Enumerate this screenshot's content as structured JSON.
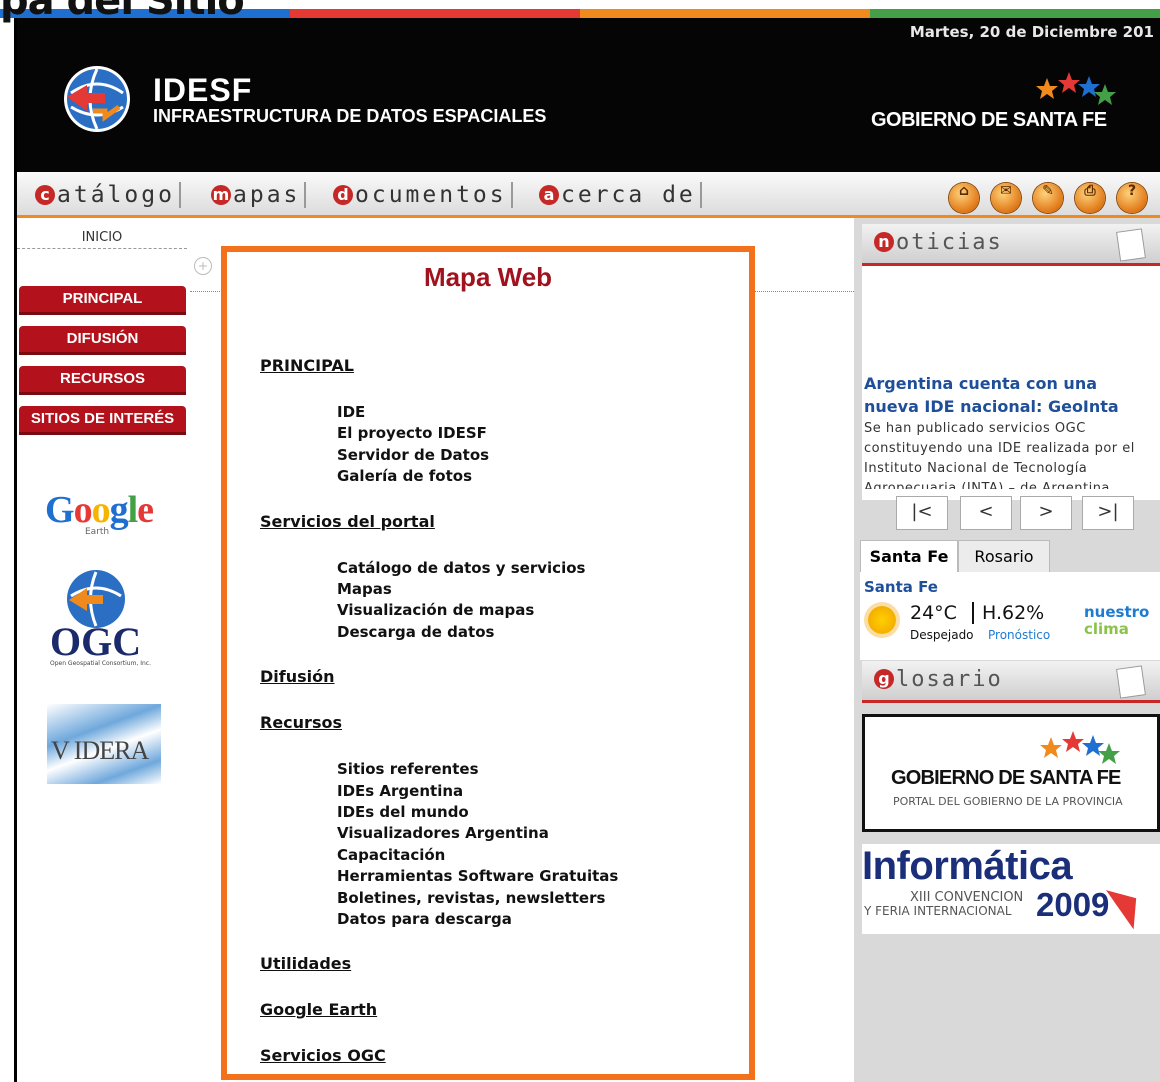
{
  "overlay": {
    "title": "pa del Sitio"
  },
  "colors": {
    "bar": [
      "#1e6fd0",
      "#e53935",
      "#f08a1c",
      "#43a047"
    ],
    "accent": "#b3111b",
    "frame": "#f4711c"
  },
  "header": {
    "date": "Martes, 20 de Diciembre 201",
    "logo_title": "IDESF",
    "logo_subtitle": "INFRAESTRUCTURA DE DATOS ESPACIALES",
    "government": "GOBIERNO DE SANTA FE"
  },
  "nav": {
    "items": [
      {
        "cap": "c",
        "rest": "atálogo"
      },
      {
        "cap": "m",
        "rest": "apas"
      },
      {
        "cap": "d",
        "rest": "ocumentos"
      },
      {
        "cap": "a",
        "rest": "cerca de"
      }
    ],
    "tools": [
      "home-icon",
      "mail-icon",
      "edit-icon",
      "print-icon",
      "help-icon"
    ],
    "tool_glyphs": [
      "⌂",
      "✉",
      "✎",
      "⎙",
      "?"
    ]
  },
  "sidebar": {
    "inicio": "INICIO",
    "buttons": [
      "PRINCIPAL",
      "DIFUSIÓN",
      "RECURSOS",
      "SITIOS DE INTERÉS"
    ],
    "google": "Google",
    "google_sub": "Earth",
    "ogc": "OGC",
    "ogc_sub": "Open Geospatial Consortium, Inc.",
    "videra": "V IDERA"
  },
  "main": {
    "title": "Mapa Web",
    "sections": [
      {
        "label": "PRINCIPAL",
        "items": [
          "IDE",
          "El proyecto IDESF",
          "Servidor de Datos",
          "Galería de fotos"
        ]
      },
      {
        "label": "Servicios del portal",
        "items": [
          "Catálogo de datos y servicios",
          "Mapas",
          "Visualización de mapas",
          "Descarga de datos"
        ]
      },
      {
        "label": "Difusión",
        "items": []
      },
      {
        "label": "Recursos",
        "items": [
          "Sitios referentes",
          "IDEs Argentina",
          "IDEs del mundo",
          "Visualizadores Argentina",
          "Capacitación",
          "Herramientas Software Gratuitas",
          "Boletines, revistas, newsletters",
          "Datos para descarga"
        ]
      },
      {
        "label": "Utilidades",
        "items": []
      },
      {
        "label": "Google Earth",
        "items": []
      },
      {
        "label": "Servicios OGC",
        "items": []
      }
    ]
  },
  "news": {
    "cap": "n",
    "header": "oticias",
    "headline": "Argentina cuenta con una nueva IDE nacional: GeoInta",
    "body": "Se han publicado servicios OGC constituyendo una IDE realizada por el Instituto Nacional de Tecnología Agropecuaria (INTA) – de Argentina.",
    "pager": [
      "|<",
      "<",
      ">",
      ">|"
    ]
  },
  "weather": {
    "tabs": [
      "Santa Fe",
      "Rosario"
    ],
    "city": "Santa Fe",
    "temp": "24°C",
    "humidity": "H.62%",
    "desc": "Despejado",
    "link": "Pronóstico",
    "brand1": "nuestro",
    "brand2": "clima"
  },
  "glossary": {
    "cap": "g",
    "header": "losario"
  },
  "ads": {
    "gob_title": "GOBIERNO DE SANTA FE",
    "gob_sub": "PORTAL DEL GOBIERNO DE LA PROVINCIA",
    "info_title": "Informática",
    "info_line1": "XIII CONVENCION",
    "info_line2": "Y FERIA INTERNACIONAL",
    "info_year": "2009"
  }
}
